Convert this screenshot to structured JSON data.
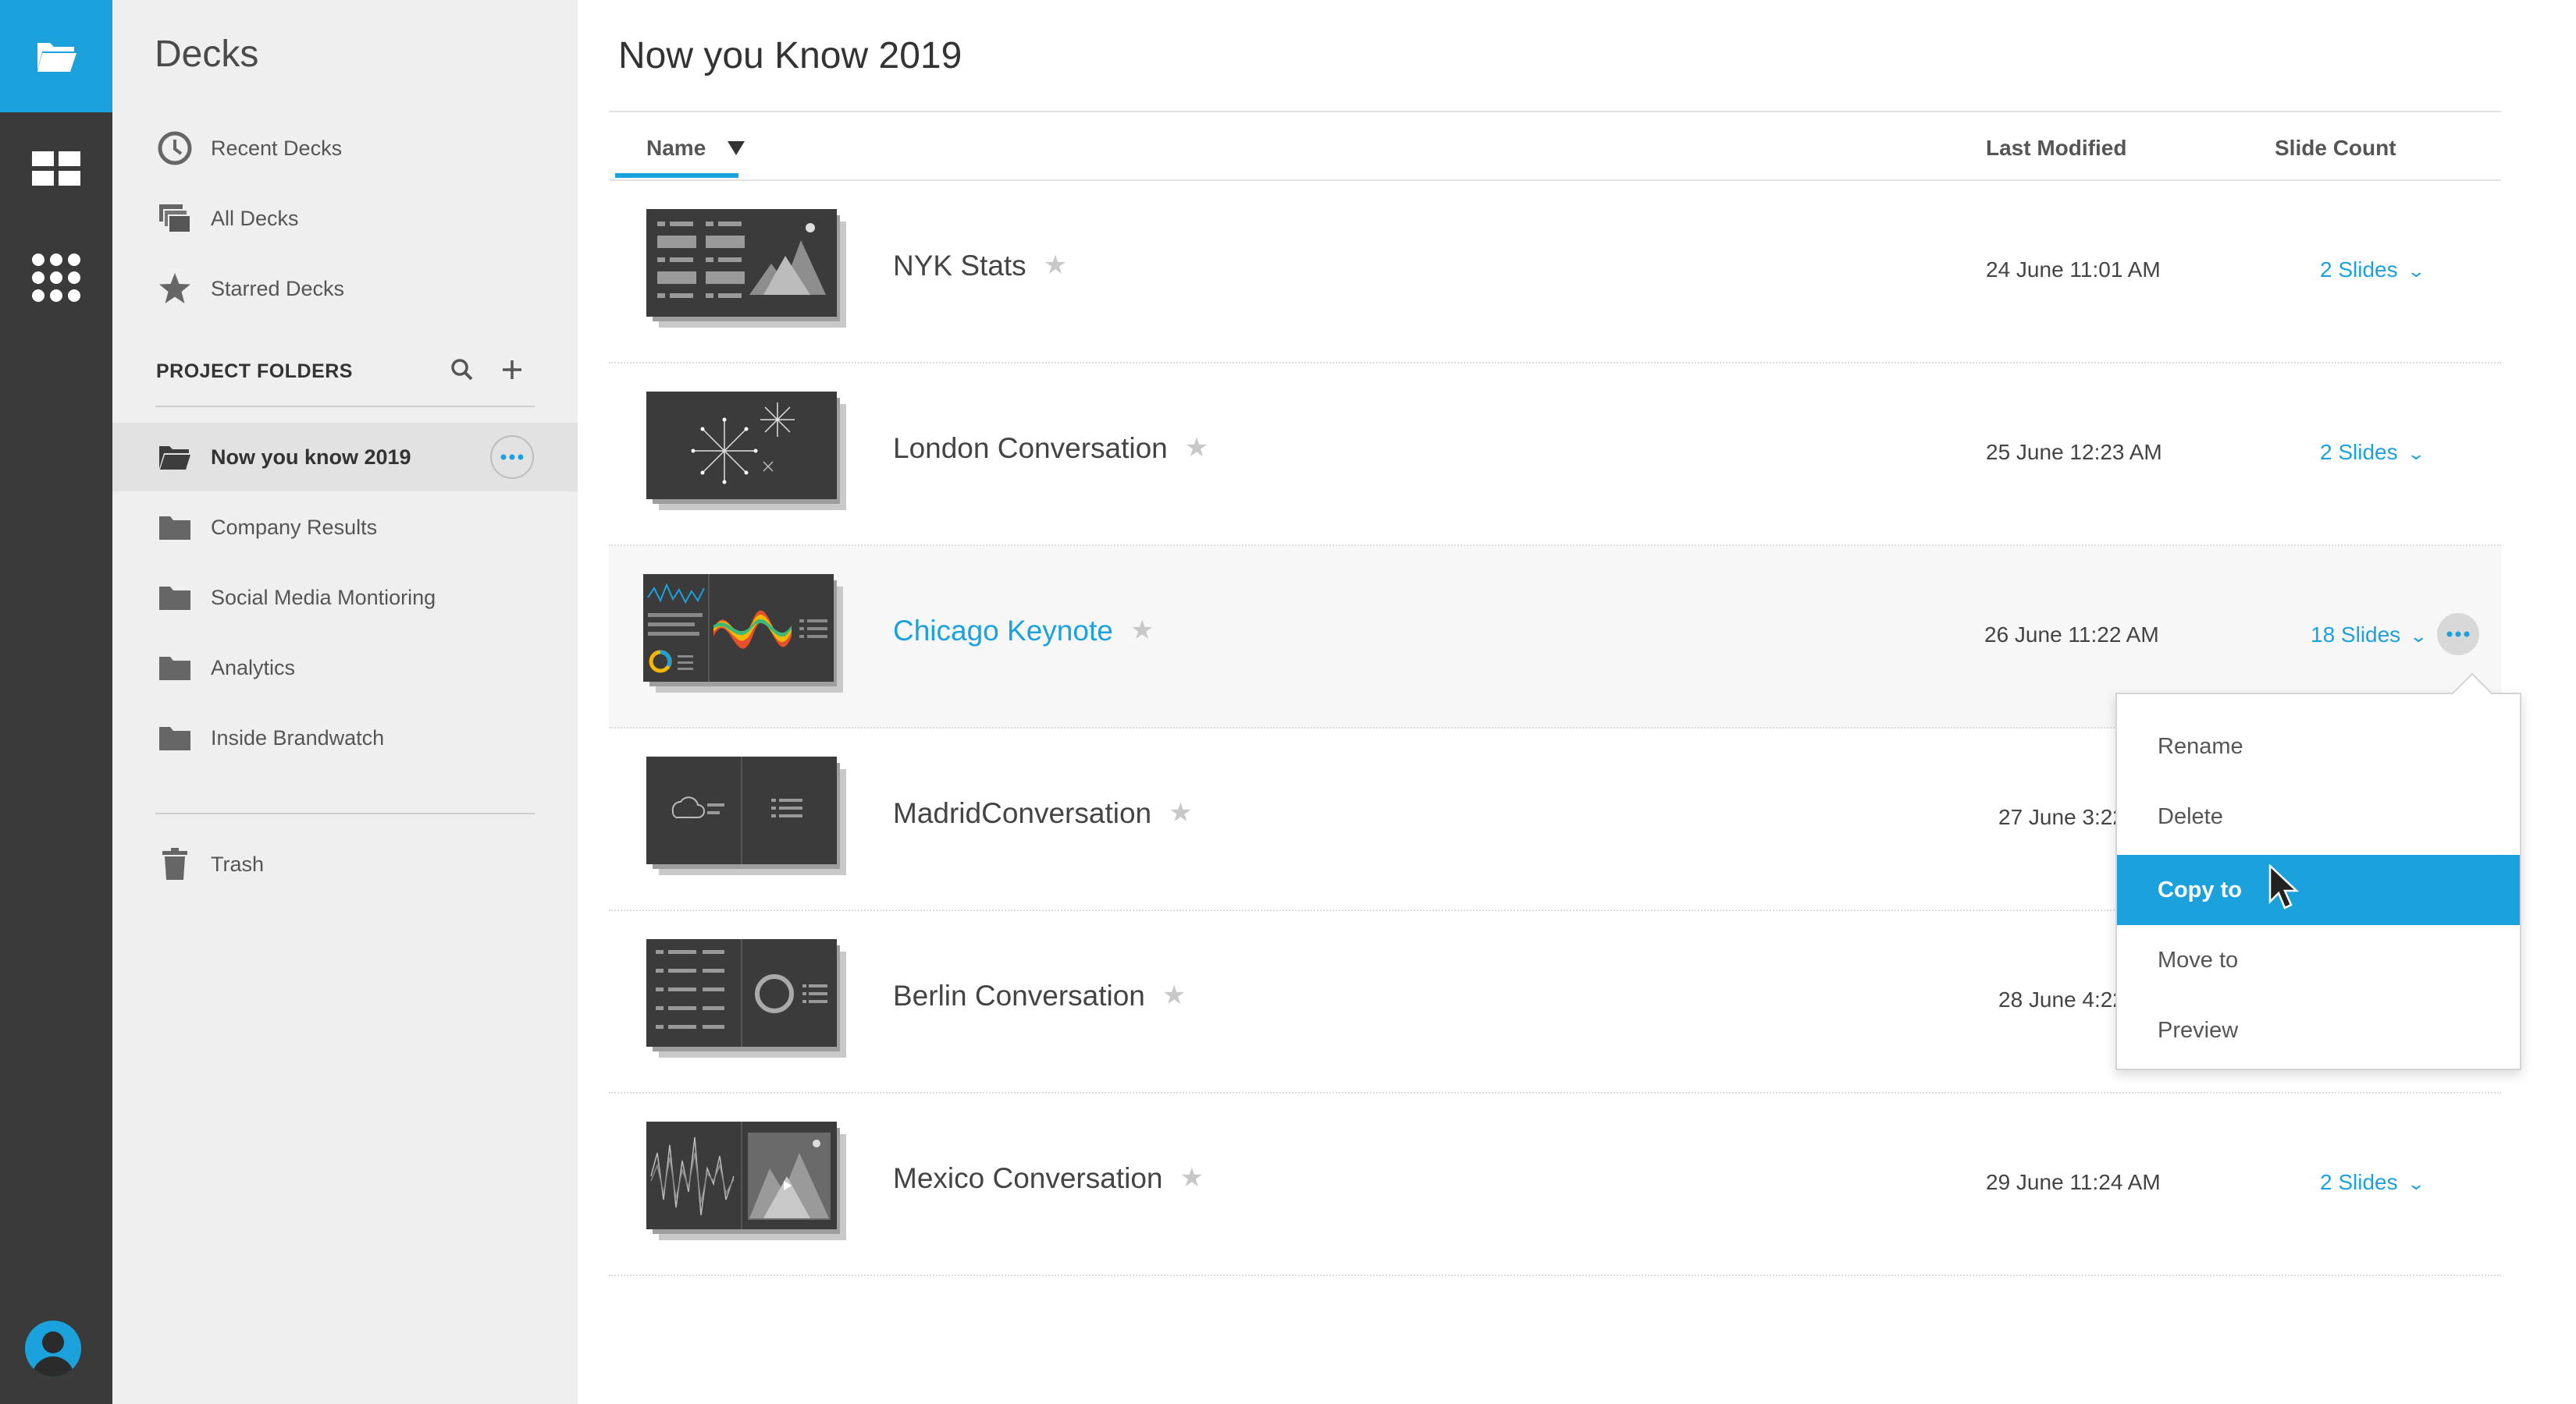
{
  "rail": {
    "icons": [
      "folder-open-icon",
      "grid-icon",
      "apps-icon",
      "user-avatar-icon"
    ],
    "accent": "#1ba1dc"
  },
  "sidebar": {
    "title": "Decks",
    "nav": [
      {
        "label": "Recent Decks",
        "icon": "clock-icon"
      },
      {
        "label": "All Decks",
        "icon": "stack-icon"
      },
      {
        "label": "Starred Decks",
        "icon": "star-icon"
      }
    ],
    "section_title": "PROJECT FOLDERS",
    "folders": [
      {
        "label": "Now you know 2019",
        "active": true
      },
      {
        "label": "Company Results"
      },
      {
        "label": "Social Media Montioring"
      },
      {
        "label": "Analytics"
      },
      {
        "label": "Inside Brandwatch"
      }
    ],
    "trash_label": "Trash"
  },
  "main": {
    "title": "Now you Know 2019",
    "columns": {
      "name": "Name",
      "modified": "Last Modified",
      "count": "Slide Count"
    },
    "rows": [
      {
        "name": "NYK Stats",
        "date": "24 June 11:01 AM",
        "slides": "2 Slides"
      },
      {
        "name": "London Conversation",
        "date": "25 June 12:23 AM",
        "slides": "2 Slides"
      },
      {
        "name": "Chicago Keynote",
        "date": "26 June 11:22 AM",
        "slides": "18 Slides"
      },
      {
        "name": "MadridConversation",
        "date": "27 June 3:22 P",
        "slides": ""
      },
      {
        "name": "Berlin Conversation",
        "date": "28 June 4:22 P",
        "slides": ""
      },
      {
        "name": "Mexico Conversation",
        "date": "29 June 11:24 AM",
        "slides": "2 Slides"
      }
    ]
  },
  "context_menu": {
    "items": [
      "Rename",
      "Delete",
      "Copy to",
      "Move to",
      "Preview"
    ],
    "selected": "Copy to"
  }
}
